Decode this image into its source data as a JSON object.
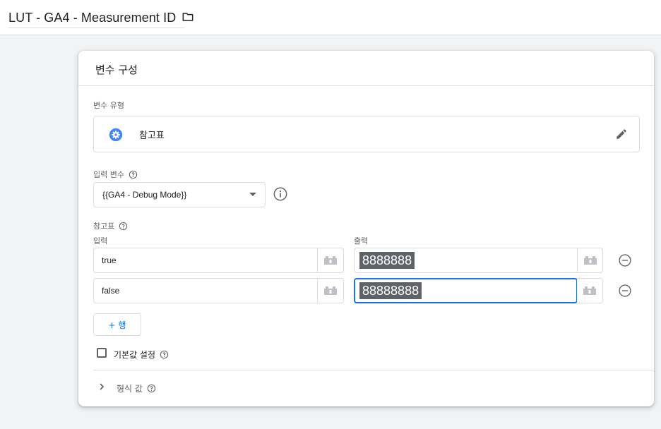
{
  "header": {
    "title": "LUT - GA4 - Measurement ID",
    "folder_icon": "folder-icon"
  },
  "card": {
    "title": "변수 구성",
    "variable_type": {
      "label": "변수 유형",
      "value": "참고표",
      "icon": "gear-icon",
      "edit_icon": "pencil-icon"
    },
    "input_variable": {
      "label": "입력 변수",
      "value": "{{GA4 - Debug Mode}}"
    },
    "lookup_table": {
      "label": "참고표",
      "input_header": "입력",
      "output_header": "출력",
      "rows": [
        {
          "input": "true",
          "output": "8888888"
        },
        {
          "input": "false",
          "output": "88888888"
        }
      ],
      "add_row_label": "+ 행"
    },
    "default_value": {
      "label": "기본값 설정",
      "checked": false
    },
    "format_value": {
      "label": "형식 값"
    }
  },
  "colors": {
    "accent": "#1a73e8",
    "gear_blue": "#4285f4",
    "text": "#202124",
    "muted": "#5f6368",
    "border": "#dadce0"
  }
}
